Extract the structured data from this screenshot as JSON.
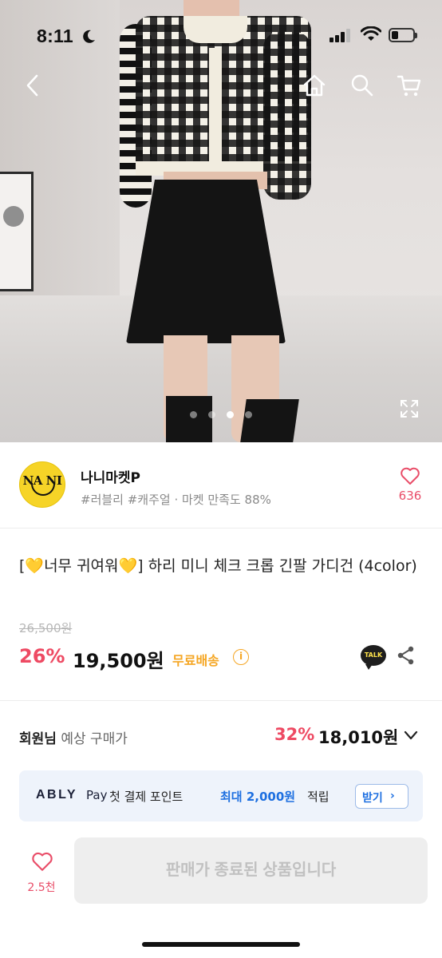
{
  "status_bar": {
    "time": "8:11",
    "moon_icon": "moon-icon",
    "signal_icon": "cellular-signal-icon",
    "wifi_icon": "wifi-icon",
    "battery_icon": "battery-icon",
    "battery_level": 0.3
  },
  "hero": {
    "image_subject": "product-photo",
    "nav": {
      "back_icon": "chevron-left-icon",
      "home_icon": "home-icon",
      "search_icon": "search-icon",
      "cart_icon": "cart-icon"
    },
    "carousel": {
      "total_pages": 4,
      "active_index": 2
    },
    "expand_icon": "expand-icon"
  },
  "shop": {
    "logo_text": "NA NI",
    "name": "나니마켓P",
    "tags": "#러블리 #캐주얼 · 마켓 만족도 88%",
    "heart_icon": "heart-outline-icon",
    "like_count": "636"
  },
  "product": {
    "title": "[💛너무 귀여워💛] 하리 미니 체크 크롭 긴팔 가디건 (4color)",
    "original_price": "26,500원",
    "discount_rate": "26%",
    "price": "19,500원",
    "shipping": "무료배송",
    "info_icon": "info-icon",
    "talk_label": "TALK",
    "share_icon": "share-icon"
  },
  "member": {
    "label_bold": "회원님",
    "label_rest": " 예상 구매가",
    "discount_rate": "32%",
    "price": "18,010원",
    "expand_icon": "chevron-down-icon"
  },
  "ably_pay": {
    "brand": "ABLY",
    "pay": "Pay",
    "msg_prefix": "첫 결제 포인트",
    "msg_highlight": "최대 2,000원",
    "msg_suffix": "적립",
    "button_label": "받기",
    "button_arrow": "›"
  },
  "bottom_bar": {
    "like_icon": "heart-outline-icon",
    "like_count": "2.5천",
    "cta_label": "판매가 종료된 상품입니다"
  },
  "colors": {
    "accent_pink": "#ee4a63",
    "shipping_orange": "#f5a623",
    "ably_blue": "#1d6fe0",
    "banner_bg": "#eef3fb",
    "logo_yellow": "#f6d427"
  }
}
